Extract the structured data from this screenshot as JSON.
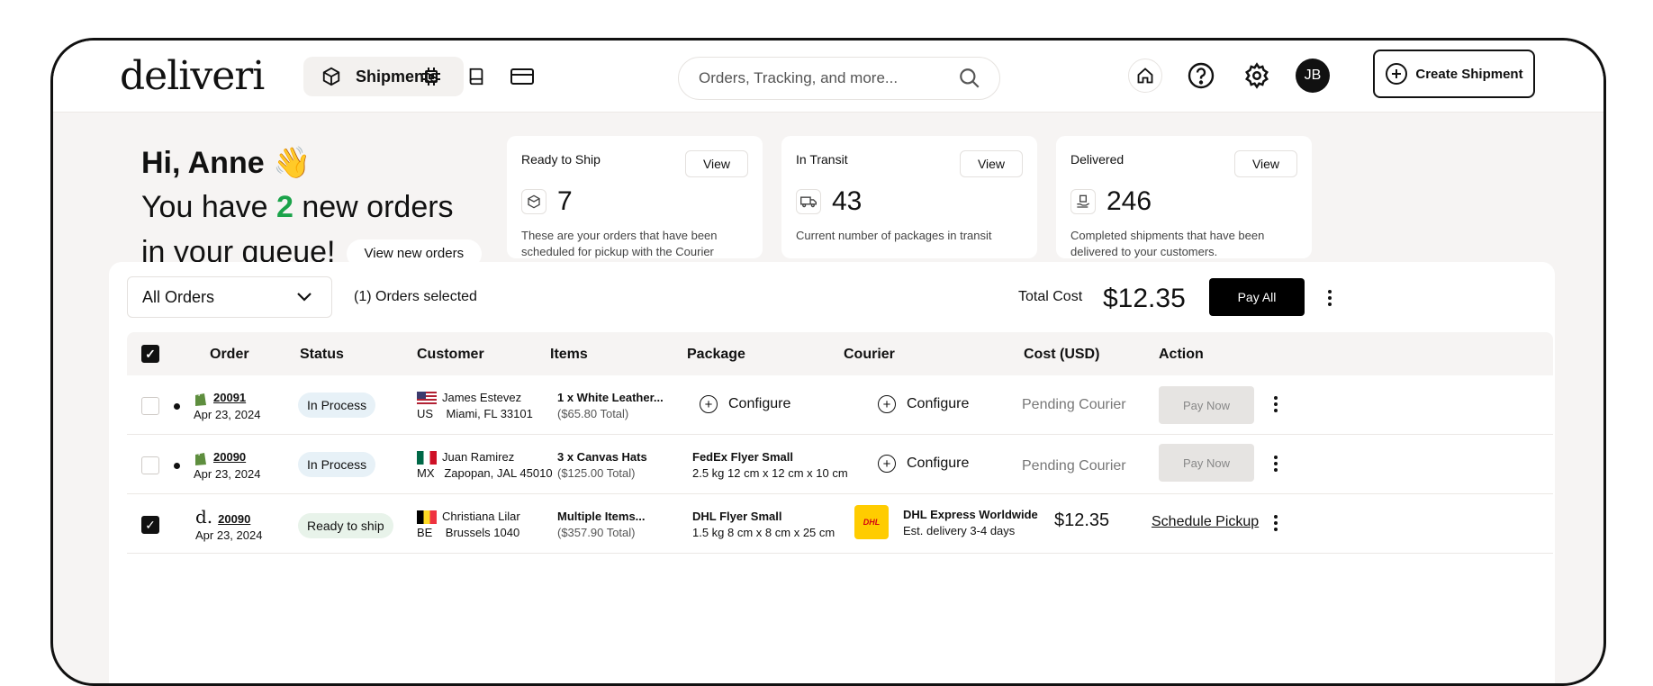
{
  "app": {
    "logo": "deliveri"
  },
  "nav": {
    "shipments": "Shipments"
  },
  "search": {
    "placeholder": "Orders, Tracking, and more..."
  },
  "user": {
    "initials": "JB"
  },
  "create_button": "Create Shipment",
  "greeting": {
    "hi": "Hi, Anne",
    "you_have": "You have ",
    "count": "2",
    "new_orders": " new orders",
    "queue": "in your queue!",
    "view_new": "View new orders"
  },
  "cards": [
    {
      "title": "Ready to Ship",
      "view": "View",
      "count": "7",
      "desc": "These are your orders that have been scheduled for pickup with the Courier"
    },
    {
      "title": "In Transit",
      "view": "View",
      "count": "43",
      "desc": "Current number of packages in transit"
    },
    {
      "title": "Delivered",
      "view": "View",
      "count": "246",
      "desc": "Completed shipments that have been delivered to your customers."
    }
  ],
  "filter": {
    "value": "All Orders"
  },
  "selection": "(1) Orders selected",
  "total": {
    "label": "Total Cost",
    "value": "$12.35"
  },
  "pay_all": "Pay All",
  "columns": [
    "Order",
    "Status",
    "Customer",
    "Items",
    "Package",
    "Courier",
    "Cost (USD)",
    "Action"
  ],
  "rows": [
    {
      "order": "20091",
      "date": "Apr 23, 2024",
      "status": "In Process",
      "name": "James Estevez",
      "country": "US",
      "address": "Miami, FL 33101",
      "items": "1 x White Leather...",
      "total": "($65.80 Total)",
      "package": "Configure",
      "courier": "Configure",
      "cost": "Pending Courier",
      "action": "Pay Now"
    },
    {
      "order": "20090",
      "date": "Apr 23, 2024",
      "status": "In Process",
      "name": "Juan Ramirez",
      "country": "MX",
      "address": "Zapopan, JAL 45010",
      "items": "3 x Canvas Hats",
      "total": "($125.00 Total)",
      "package": "FedEx Flyer Small",
      "package_dims": "2.5 kg 12 cm x 12 cm x 10 cm",
      "courier": "Configure",
      "cost": "Pending Courier",
      "action": "Pay Now"
    },
    {
      "order": "20090",
      "date": "Apr 23, 2024",
      "status": "Ready to ship",
      "name": "Christiana Lilar",
      "country": "BE",
      "address": "Brussels 1040",
      "items": "Multiple Items...",
      "total": "($357.90 Total)",
      "package": "DHL Flyer Small",
      "package_dims": "1.5 kg 8 cm x 8 cm x 25 cm",
      "courier": "DHL Express Worldwide",
      "courier_eta": "Est. delivery 3-4 days",
      "courier_logo": "DHL",
      "cost": "$12.35",
      "action": "Schedule Pickup"
    }
  ],
  "colors": {
    "accent_green": "#1ba34a",
    "dhl_yellow": "#ffcc00",
    "dhl_red": "#d40511"
  }
}
